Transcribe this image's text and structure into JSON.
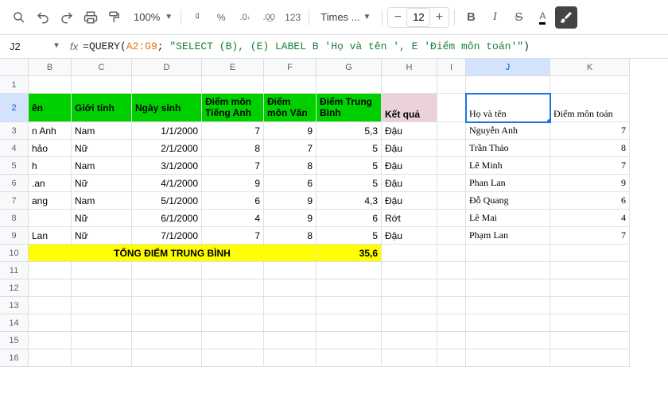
{
  "toolbar": {
    "zoom": "100%",
    "font": "Times ...",
    "font_size": "12",
    "currency": "₫",
    "percent": "%",
    "dec_less": ".0",
    "dec_more": ".00",
    "num_format": "123",
    "bold": "B",
    "italic": "I",
    "strike": "S",
    "color": "A"
  },
  "formula_bar": {
    "cell_ref": "J2",
    "prefix": "=QUERY(",
    "range": "A2:G9",
    "suffix1": "; ",
    "query_string": "\"SELECT (B), (E) LABEL B 'Họ và tên ', E 'Điểm môn toán'\"",
    "suffix2": ")"
  },
  "columns": [
    "B",
    "C",
    "D",
    "E",
    "F",
    "G",
    "H",
    "I",
    "J",
    "K"
  ],
  "active_col": "J",
  "active_row": "2",
  "headers": {
    "B": "ên",
    "C": "Giới tính",
    "D": "Ngày sinh",
    "E": "Điểm môn Tiếng Anh",
    "F": "Điểm môn Văn",
    "G": "Điểm Trung Bình",
    "H": "Kết quả",
    "J": "Họ và tên",
    "K": "Điểm môn toán"
  },
  "rows": [
    {
      "n": "3",
      "B": "n Anh",
      "C": "Nam",
      "D": "1/1/2000",
      "E": "7",
      "F": "9",
      "G": "5,3",
      "H": "Đậu",
      "J": "Nguyễn Anh",
      "K": "7"
    },
    {
      "n": "4",
      "B": "hảo",
      "C": "Nữ",
      "D": "2/1/2000",
      "E": "8",
      "F": "7",
      "G": "5",
      "H": "Đậu",
      "J": "Trần Thảo",
      "K": "8"
    },
    {
      "n": "5",
      "B": "h",
      "C": "Nam",
      "D": "3/1/2000",
      "E": "7",
      "F": "8",
      "G": "5",
      "H": "Đậu",
      "J": "Lê Minh",
      "K": "7"
    },
    {
      "n": "6",
      "B": ".an",
      "C": "Nữ",
      "D": "4/1/2000",
      "E": "9",
      "F": "6",
      "G": "5",
      "H": "Đậu",
      "J": "Phan Lan",
      "K": "9"
    },
    {
      "n": "7",
      "B": "ang",
      "C": "Nam",
      "D": "5/1/2000",
      "E": "6",
      "F": "9",
      "G": "4,3",
      "H": "Đậu",
      "J": "Đỗ Quang",
      "K": "6"
    },
    {
      "n": "8",
      "B": "",
      "C": "Nữ",
      "D": "6/1/2000",
      "E": "4",
      "F": "9",
      "G": "6",
      "H": "Rớt",
      "J": "Lê Mai",
      "K": "4"
    },
    {
      "n": "9",
      "B": "Lan",
      "C": "Nữ",
      "D": "7/1/2000",
      "E": "7",
      "F": "8",
      "G": "5",
      "H": "Đậu",
      "J": "Phạm Lan",
      "K": "7"
    }
  ],
  "total": {
    "label": "TỔNG ĐIỂM TRUNG BÌNH",
    "value": "35,6"
  },
  "empty_rows": [
    "11",
    "12",
    "13",
    "14",
    "15",
    "16"
  ]
}
